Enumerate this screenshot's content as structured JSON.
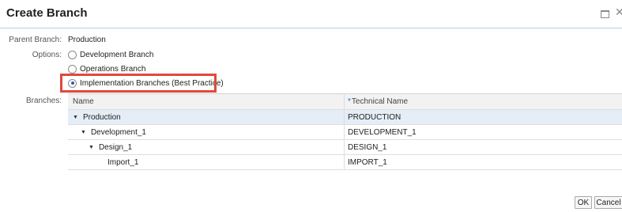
{
  "dialog": {
    "title": "Create Branch",
    "restore_icon": "restore-window-icon",
    "close_glyph": "✕"
  },
  "form": {
    "parent_branch_label": "Parent Branch:",
    "parent_branch_value": "Production",
    "options_label": "Options:",
    "options": [
      {
        "label": "Development Branch",
        "selected": false
      },
      {
        "label": "Operations Branch",
        "selected": false
      },
      {
        "label": "Implementation Branches (Best Practice)",
        "selected": true
      }
    ],
    "branches_label": "Branches:"
  },
  "table": {
    "columns": [
      {
        "label": "Name",
        "required": false
      },
      {
        "label": "Technical Name",
        "required": true,
        "required_marker": "*"
      }
    ],
    "rows": [
      {
        "name": "Production",
        "technical_name": "PRODUCTION",
        "expanded": true,
        "level": 0
      },
      {
        "name": "Development_1",
        "technical_name": "DEVELOPMENT_1",
        "expanded": true,
        "level": 1
      },
      {
        "name": "Design_1",
        "technical_name": "DESIGN_1",
        "expanded": true,
        "level": 2
      },
      {
        "name": "Import_1",
        "technical_name": "IMPORT_1",
        "expanded": false,
        "level": 3
      }
    ]
  },
  "buttons": {
    "ok": "OK",
    "cancel": "Cancel"
  },
  "colors": {
    "highlight": "#e04a3a",
    "accent": "#2a6ad2",
    "selected_row": "#e5edf6"
  }
}
